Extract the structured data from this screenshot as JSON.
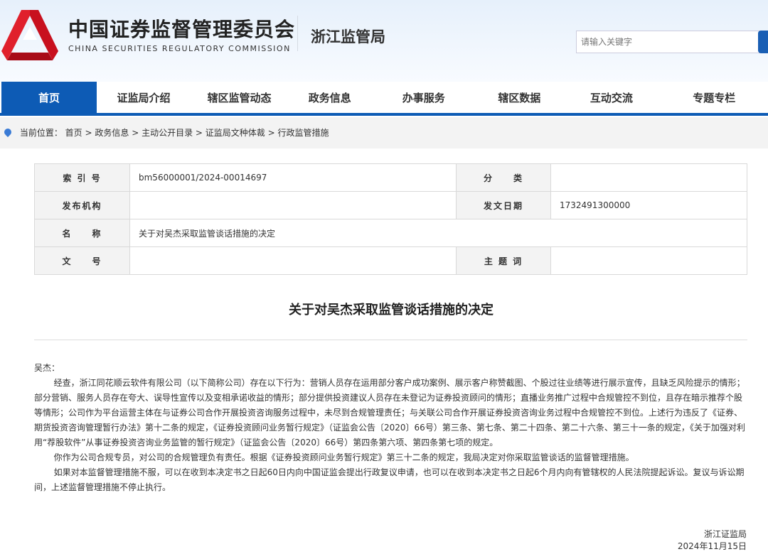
{
  "header": {
    "org_cn": "中国证券监督管理委员会",
    "org_en": "CHINA SECURITIES REGULATORY COMMISSION",
    "bureau": "浙江监管局",
    "search_placeholder": "请输入关键字"
  },
  "nav": [
    "首页",
    "证监局介绍",
    "辖区监管动态",
    "政务信息",
    "办事服务",
    "辖区数据",
    "互动交流",
    "专题专栏"
  ],
  "breadcrumb": {
    "label": "当前位置：",
    "items": [
      "首页",
      "政务信息",
      "主动公开目录",
      "证监局文种体裁",
      "行政监管措施"
    ]
  },
  "meta": {
    "index_label": "索 引 号",
    "index_value": "bm56000001/2024-00014697",
    "category_label": "分　　类",
    "category_value": "",
    "issuer_label": "发布机构",
    "issuer_value": "",
    "date_label": "发文日期",
    "date_value": "1732491300000",
    "name_label": "名　　称",
    "name_value": "关于对吴杰采取监管谈话措施的决定",
    "docno_label": "文　　号",
    "docno_value": "",
    "keywords_label": "主 题 词",
    "keywords_value": ""
  },
  "doc": {
    "title": "关于对吴杰采取监管谈话措施的决定",
    "salutation": "吴杰：",
    "paragraphs": [
      "经查，浙江同花顺云软件有限公司（以下简称公司）存在以下行为：营销人员存在运用部分客户成功案例、展示客户称赞截图、个股过往业绩等进行展示宣传，且缺乏风险提示的情形；部分营销、服务人员存在夸大、误导性宣传以及变相承诺收益的情形；部分提供投资建议人员存在未登记为证券投资顾问的情形；直播业务推广过程中合规管控不到位，且存在暗示推荐个股等情形；公司作为平台运营主体在与证券公司合作开展投资咨询服务过程中，未尽到合规管理责任；与关联公司合作开展证券投资咨询业务过程中合规管控不到位。上述行为违反了《证券、期货投资咨询管理暂行办法》第十二条的规定，《证券投资顾问业务暂行规定》（证监会公告〔2020〕66号）第三条、第七条、第二十四条、第二十六条、第三十一条的规定，《关于加强对利用“荐股软件”从事证券投资咨询业务监管的暂行规定》（证监会公告〔2020〕66号）第四条第六项、第四条第七项的规定。",
      "你作为公司合规专员，对公司的合规管理负有责任。根据《证券投资顾问业务暂行规定》第三十二条的规定，我局决定对你采取监管谈话的监督管理措施。",
      "如果对本监督管理措施不服，可以在收到本决定书之日起60日内向中国证监会提出行政复议申请，也可以在收到本决定书之日起6个月内向有管辖权的人民法院提起诉讼。复议与诉讼期间，上述监督管理措施不停止执行。"
    ],
    "signature": "浙江证监局",
    "date": "2024年11月15日"
  }
}
